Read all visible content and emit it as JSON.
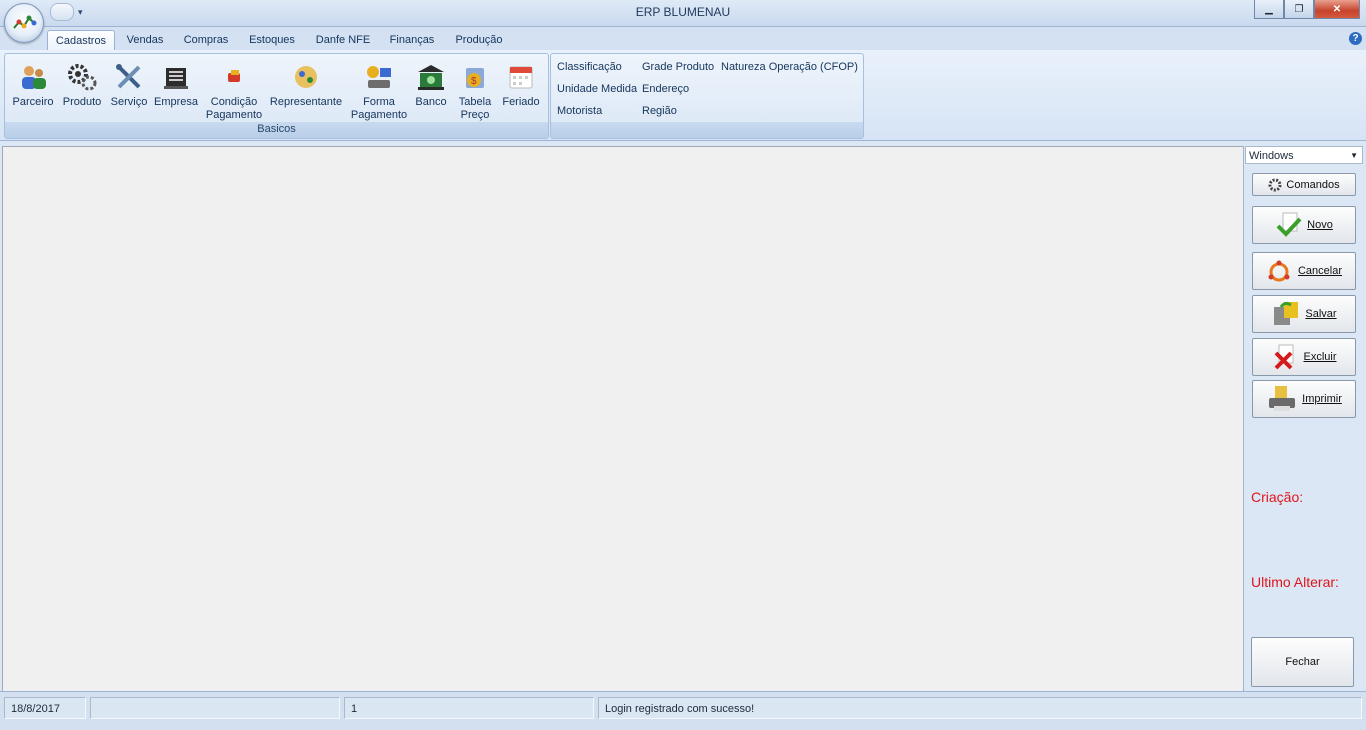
{
  "window": {
    "title": "ERP BLUMENAU"
  },
  "tabs": [
    {
      "label": "Cadastros",
      "active": true
    },
    {
      "label": "Vendas"
    },
    {
      "label": "Compras"
    },
    {
      "label": "Estoques"
    },
    {
      "label": "Danfe NFE"
    },
    {
      "label": "Finanças"
    },
    {
      "label": "Produção"
    }
  ],
  "ribbon": {
    "basicos": {
      "label": "Basicos",
      "buttons": [
        {
          "label": "Parceiro",
          "icon": "users-icon"
        },
        {
          "label": "Produto",
          "icon": "gears-icon"
        },
        {
          "label": "Serviço",
          "icon": "tools-icon"
        },
        {
          "label": "Empresa",
          "icon": "building-icon"
        },
        {
          "label1": "Condição",
          "label2": "Pagamento",
          "icon": "payment-condition-icon"
        },
        {
          "label": "Representante",
          "icon": "representative-icon"
        },
        {
          "label1": "Forma",
          "label2": "Pagamento",
          "icon": "payment-method-icon"
        },
        {
          "label": "Banco",
          "icon": "bank-icon"
        },
        {
          "label1": "Tabela",
          "label2": "Preço",
          "icon": "price-table-icon"
        },
        {
          "label": "Feriado",
          "icon": "calendar-icon"
        }
      ]
    },
    "links": {
      "classificacao": "Classificação",
      "unidade_medida": "Unidade Medida",
      "motorista": "Motorista",
      "grade_produto": "Grade Produto",
      "endereco": "Endereço",
      "regiao": "Região",
      "natureza_operacao": "Natureza Operação (CFOP)"
    }
  },
  "sidebar": {
    "combo_value": "Windows",
    "comandos": "Comandos",
    "novo": "Novo",
    "cancelar": "Cancelar",
    "salvar": "Salvar",
    "excluir": "Excluir",
    "imprimir": "Imprimir",
    "criacao": "Criação:",
    "ultimo_alterar": "Ultimo Alterar:",
    "fechar": "Fechar"
  },
  "statusbar": {
    "date": "18/8/2017",
    "cell2": "",
    "cell3": "1",
    "message": "Login registrado com sucesso!"
  },
  "colors": {
    "accent": "#2d6bc0",
    "alert_red": "#e0151b"
  }
}
